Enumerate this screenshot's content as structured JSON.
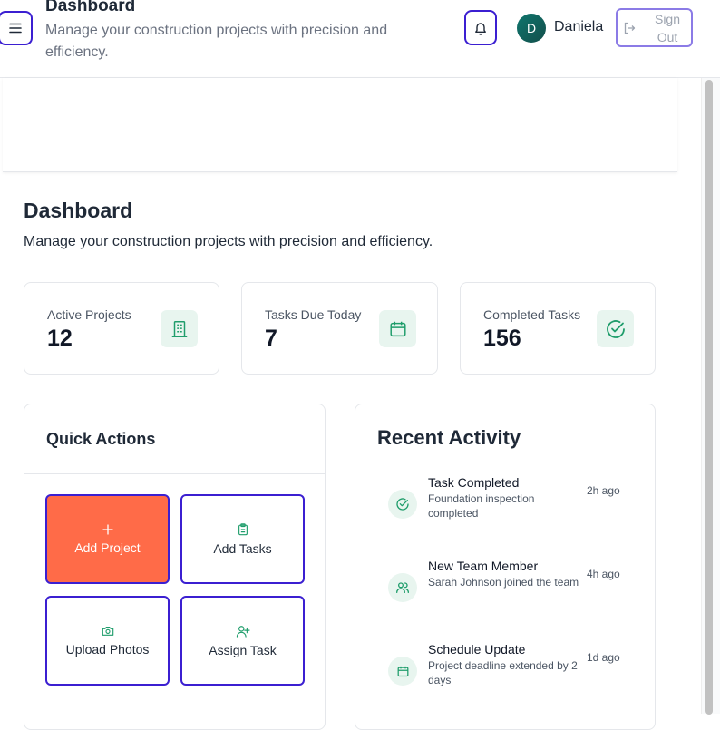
{
  "header": {
    "title": "Dashboard",
    "subtitle": "Manage your construction projects with precision and efficiency.",
    "user_initial": "D",
    "user_name": "Daniela",
    "signout_label": "Sign Out"
  },
  "page": {
    "title": "Dashboard",
    "subtitle": "Manage your construction projects with precision and efficiency."
  },
  "stats": [
    {
      "label": "Active Projects",
      "value": "12",
      "icon": "building-icon"
    },
    {
      "label": "Tasks Due Today",
      "value": "7",
      "icon": "calendar-icon"
    },
    {
      "label": "Completed Tasks",
      "value": "156",
      "icon": "check-circle-icon"
    }
  ],
  "quick_actions": {
    "title": "Quick Actions",
    "items": [
      {
        "label": "Add Project",
        "icon": "plus-icon"
      },
      {
        "label": "Add Tasks",
        "icon": "clipboard-icon"
      },
      {
        "label": "Upload Photos",
        "icon": "camera-icon"
      },
      {
        "label": "Assign Task",
        "icon": "user-plus-icon"
      }
    ]
  },
  "recent_activity": {
    "title": "Recent Activity",
    "items": [
      {
        "title": "Task Completed",
        "desc": "Foundation inspection completed",
        "time": "2h ago",
        "icon": "check-circle-icon"
      },
      {
        "title": "New Team Member",
        "desc": "Sarah Johnson joined the team",
        "time": "4h ago",
        "icon": "users-icon"
      },
      {
        "title": "Schedule Update",
        "desc": "Project deadline extended by 2 days",
        "time": "1d ago",
        "icon": "calendar-icon"
      }
    ]
  },
  "colors": {
    "accent": "#3b1fd1",
    "primary_action": "#ff6b48",
    "icon_green": "#1f9d6b",
    "icon_bg": "#e8f5ef"
  }
}
